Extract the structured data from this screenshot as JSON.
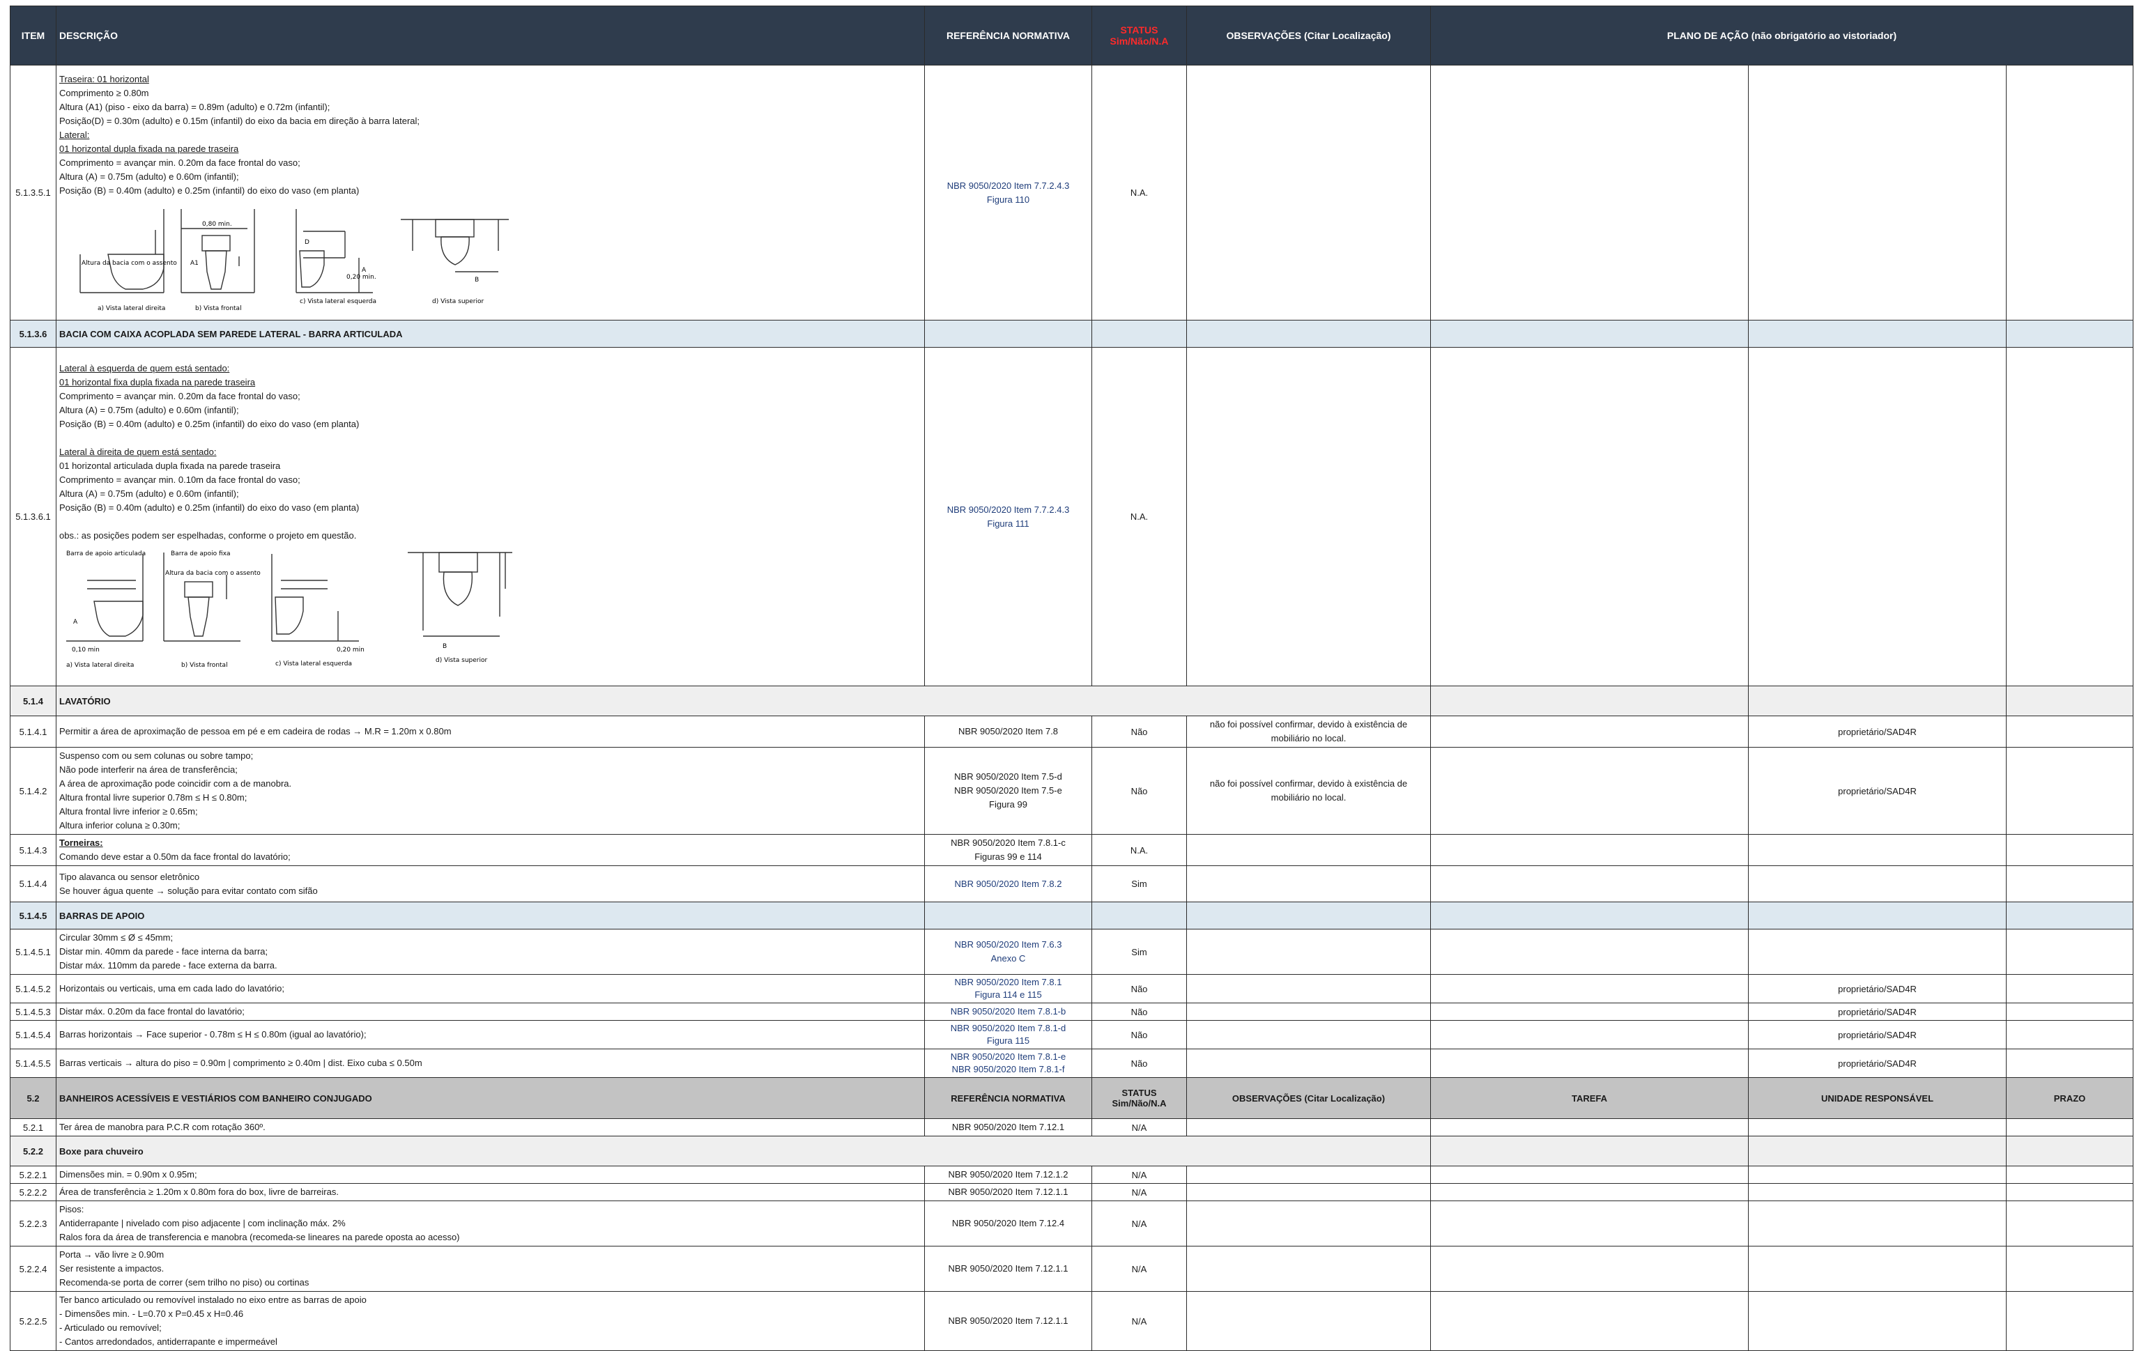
{
  "header": {
    "item": "ITEM",
    "descricao": "DESCRIÇÃO",
    "referencia": "REFERÊNCIA NORMATIVA",
    "status_line1": "STATUS",
    "status_line2": "Sim/Não/N.A",
    "observacoes": "OBSERVAÇÕES (Citar Localização)",
    "plano": "PLANO DE AÇÃO (não obrigatório ao vistoriador)"
  },
  "rows": {
    "r1": {
      "item": "5.1.3.5.1",
      "lines": [
        "Traseira: 01 horizontal",
        "Comprimento ≥ 0.80m",
        "Altura (A1) (piso - eixo da barra) = 0.89m (adulto) e 0.72m (infantil);",
        "Posição(D) = 0.30m (adulto) e 0.15m (infantil) do eixo da bacia em direção à barra lateral;",
        "Lateral:",
        "01 horizontal dupla fixada na parede traseira",
        "Comprimento = avançar min. 0.20m da face frontal do vaso;",
        "Altura (A) = 0.75m (adulto) e 0.60m (infantil);",
        "Posição (B) = 0.40m (adulto) e 0.25m (infantil) do eixo do vaso (em planta)"
      ],
      "fig_labels": [
        "a) Vista lateral direita",
        "b) Vista frontal",
        "c) Vista lateral esquerda",
        "d) Vista superior",
        "0,80 min.",
        "Altura da bacia com o assento",
        "0,20 min.",
        "A1",
        "A",
        "B",
        "D"
      ],
      "ref1": "NBR 9050/2020 Item 7.7.2.4.3",
      "ref2": "Figura 110",
      "status": "N.A."
    },
    "s1": {
      "item": "5.1.3.6",
      "title": "BACIA COM CAIXA ACOPLADA SEM PAREDE LATERAL - BARRA ARTICULADA"
    },
    "r2": {
      "item": "5.1.3.6.1",
      "lines": [
        "Lateral à esquerda de quem está sentado:",
        "01 horizontal fixa dupla fixada na parede traseira",
        "Comprimento = avançar min. 0.20m da face frontal do vaso;",
        "Altura (A) = 0.75m (adulto) e 0.60m (infantil);",
        "Posição (B) = 0.40m (adulto) e 0.25m (infantil) do eixo do vaso (em planta)",
        "",
        "Lateral à direita de quem está sentado:",
        "01 horizontal articulada dupla fixada na parede traseira",
        "Comprimento = avançar min. 0.10m da face frontal do vaso;",
        "Altura (A) = 0.75m (adulto) e 0.60m (infantil);",
        "Posição (B) = 0.40m (adulto) e 0.25m (infantil) do eixo do vaso (em planta)",
        "",
        "obs.: as posições podem ser espelhadas, conforme o projeto em questão."
      ],
      "fig_labels": [
        "a) Vista lateral direita",
        "b) Vista frontal",
        "c) Vista lateral esquerda",
        "d) Vista superior",
        "Barra de apoio articulada",
        "Barra de apoio fixa",
        "Altura da bacia com o assento",
        "0,10 min",
        "0,20 min",
        "A",
        "B"
      ],
      "ref1": "NBR 9050/2020 Item 7.7.2.4.3",
      "ref2": "Figura 111",
      "status": "N.A."
    },
    "s2": {
      "item": "5.1.4",
      "title": "LAVATÓRIO"
    },
    "r3": {
      "item": "5.1.4.1",
      "lines": [
        "Permitir a área de aproximação de pessoa em pé e em cadeira de rodas → M.R = 1.20m x 0.80m"
      ],
      "ref1": "NBR 9050/2020 Item 7.8",
      "status": "Não",
      "obs": "não foi possível confirmar, devido à existência de mobiliário no local.",
      "resp": "proprietário/SAD4R"
    },
    "r4": {
      "item": "5.1.4.2",
      "lines": [
        "Suspenso com ou sem colunas ou sobre tampo;",
        "Não pode interferir na área de transferência;",
        "A área de aproximação pode coincidir com a de manobra.",
        "Altura frontal livre superior  0.78m ≤ H ≤ 0.80m;",
        "Altura frontal livre inferior ≥ 0.65m;",
        "Altura inferior coluna ≥ 0.30m;"
      ],
      "ref1": "NBR 9050/2020 Item 7.5-d",
      "ref2": "NBR 9050/2020 Item 7.5-e",
      "ref3": "Figura 99",
      "status": "Não",
      "obs": "não foi possível confirmar, devido à existência de mobiliário no local.",
      "resp": "proprietário/SAD4R"
    },
    "r5": {
      "item": "5.1.4.3",
      "line1": "Torneiras:",
      "line2": "Comando deve estar a 0.50m da face frontal do lavatório;",
      "ref1": "NBR 9050/2020 Item 7.8.1-c",
      "ref2": "Figuras 99 e 114",
      "status": "N.A."
    },
    "r6": {
      "item": "5.1.4.4",
      "lines": [
        "Tipo alavanca ou sensor eletrônico",
        "Se houver água quente → solução para evitar contato com sifão"
      ],
      "ref1": "NBR 9050/2020 Item 7.8.2",
      "status": "Sim"
    },
    "s3": {
      "item": "5.1.4.5",
      "title": "BARRAS DE APOIO"
    },
    "r7": {
      "item": "5.1.4.5.1",
      "lines": [
        "Circular 30mm ≤ Ø ≤ 45mm;",
        "Distar min. 40mm da parede - face interna da barra;",
        "Distar máx. 110mm da parede - face externa da barra."
      ],
      "ref1": "NBR 9050/2020 Item 7.6.3",
      "ref2": "Anexo C",
      "status": "Sim"
    },
    "r8": {
      "item": "5.1.4.5.2",
      "lines": [
        "Horizontais ou verticais, uma em cada lado do lavatório;"
      ],
      "ref1": "NBR 9050/2020 Item 7.8.1",
      "ref2": "Figura 114 e 115",
      "status": "Não",
      "resp": "proprietário/SAD4R"
    },
    "r9": {
      "item": "5.1.4.5.3",
      "lines": [
        "Distar máx. 0.20m da face frontal do lavatório;"
      ],
      "ref1": "NBR 9050/2020 Item 7.8.1-b",
      "status": "Não",
      "resp": "proprietário/SAD4R"
    },
    "r10": {
      "item": "5.1.4.5.4",
      "lines": [
        "Barras horizontais → Face superior - 0.78m ≤ H ≤ 0.80m (igual ao lavatório);"
      ],
      "ref1": "NBR 9050/2020 Item 7.8.1-d",
      "ref2": "Figura 115",
      "status": "Não",
      "resp": "proprietário/SAD4R"
    },
    "r11": {
      "item": "5.1.4.5.5",
      "lines": [
        "Barras verticais → altura do piso = 0.90m | comprimento ≥ 0.40m | dist. Eixo cuba ≤ 0.50m"
      ],
      "ref1": "NBR 9050/2020 Item 7.8.1-e",
      "ref2": "NBR 9050/2020 Item 7.8.1-f",
      "status": "Não",
      "resp": "proprietário/SAD4R"
    },
    "s4": {
      "item": "5.2",
      "title": "BANHEIROS ACESSÍVEIS E VESTIÁRIOS COM BANHEIRO CONJUGADO",
      "ref": "REFERÊNCIA NORMATIVA",
      "status_line1": "STATUS",
      "status_line2": "Sim/Não/N.A",
      "obs": "OBSERVAÇÕES (Citar Localização)",
      "tarefa": "TAREFA",
      "unidade": "UNIDADE RESPONSÁVEL",
      "prazo": "PRAZO"
    },
    "r12": {
      "item": "5.2.1",
      "lines": [
        "Ter área de manobra para P.C.R com rotação 360º."
      ],
      "ref1": "NBR 9050/2020 Item 7.12.1",
      "status": "N/A"
    },
    "s5": {
      "item": "5.2.2",
      "title": "Boxe para chuveiro"
    },
    "r13": {
      "item": "5.2.2.1",
      "lines": [
        "Dimensões min. = 0.90m x 0.95m;"
      ],
      "ref1": "NBR 9050/2020 Item 7.12.1.2",
      "status": "N/A"
    },
    "r14": {
      "item": "5.2.2.2",
      "lines": [
        "Área de transferência ≥ 1.20m x 0.80m fora do box, livre de barreiras."
      ],
      "ref1": "NBR 9050/2020 Item 7.12.1.1",
      "status": "N/A"
    },
    "r15": {
      "item": "5.2.2.3",
      "lines": [
        "Pisos:",
        "Antiderrapante | nivelado com piso adjacente | com inclinação máx. 2%",
        "Ralos fora da área de transferencia e manobra (recomeda-se lineares na parede oposta ao acesso)"
      ],
      "ref1": "NBR 9050/2020 Item 7.12.4",
      "status": "N/A"
    },
    "r16": {
      "item": "5.2.2.4",
      "lines": [
        "Porta → vão livre ≥ 0.90m",
        "Ser resistente a impactos.",
        "Recomenda-se porta de correr (sem trilho no piso) ou cortinas"
      ],
      "ref1": "NBR 9050/2020 Item 7.12.1.1",
      "status": "N/A"
    },
    "r17": {
      "item": "5.2.2.5",
      "lines": [
        "Ter banco articulado ou removível instalado no eixo entre as barras de apoio",
        "- Dimensões min. - L=0.70 x P=0.45 x H=0.46",
        "- Articulado ou removível;",
        "- Cantos arredondados, antiderrapante e impermeável"
      ],
      "ref1": "NBR 9050/2020 Item 7.12.1.1",
      "status": "N/A"
    }
  }
}
